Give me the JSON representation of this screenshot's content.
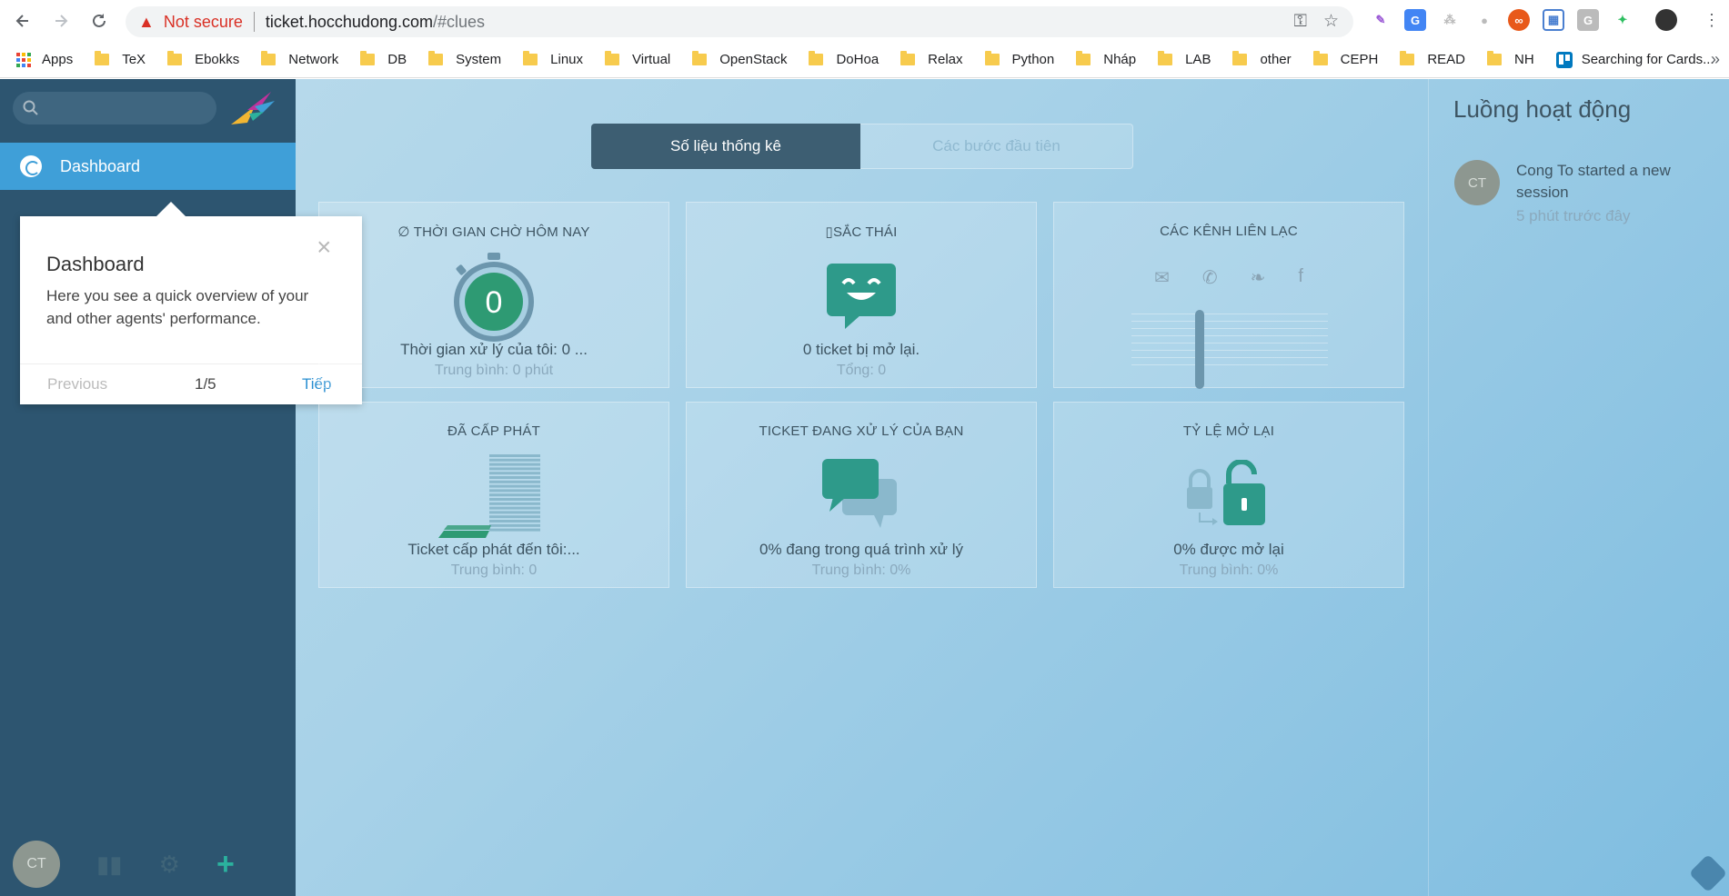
{
  "browser": {
    "security_label": "Not secure",
    "url_host": "ticket.hocchudong.com",
    "url_path": "/#clues",
    "bookmarks": [
      {
        "label": "Apps",
        "kind": "apps"
      },
      {
        "label": "TeX",
        "kind": "folder"
      },
      {
        "label": "Ebokks",
        "kind": "folder"
      },
      {
        "label": "Network",
        "kind": "folder"
      },
      {
        "label": "DB",
        "kind": "folder"
      },
      {
        "label": "System",
        "kind": "folder"
      },
      {
        "label": "Linux",
        "kind": "folder"
      },
      {
        "label": "Virtual",
        "kind": "folder"
      },
      {
        "label": "OpenStack",
        "kind": "folder"
      },
      {
        "label": "DoHoa",
        "kind": "folder"
      },
      {
        "label": "Relax",
        "kind": "folder"
      },
      {
        "label": "Python",
        "kind": "folder"
      },
      {
        "label": "Nháp",
        "kind": "folder"
      },
      {
        "label": "LAB",
        "kind": "folder"
      },
      {
        "label": "other",
        "kind": "folder"
      },
      {
        "label": "CEPH",
        "kind": "folder"
      },
      {
        "label": "READ",
        "kind": "folder"
      },
      {
        "label": "NH",
        "kind": "folder"
      },
      {
        "label": "Searching for Cards...",
        "kind": "trello"
      }
    ]
  },
  "sidebar": {
    "dashboard_label": "Dashboard",
    "user_initials": "CT"
  },
  "tooltip": {
    "title": "Dashboard",
    "body": "Here you see a quick overview of your and other agents' performance.",
    "previous": "Previous",
    "step": "1/5",
    "next": "Tiếp"
  },
  "tabs": {
    "stats": "Số liệu thống kê",
    "first_steps": "Các bước đầu tiên"
  },
  "cards": {
    "waiting": {
      "title": "∅ THỜI GIAN CHỜ HÔM NAY",
      "value": "0",
      "main": "Thời gian xử lý của tôi: 0 ...",
      "sub": "Trung bình: 0 phút"
    },
    "mood": {
      "title": "▯SẮC THÁI",
      "main": "0 ticket bị mở lại.",
      "sub": "Tổng: 0"
    },
    "channels": {
      "title": "CÁC KÊNH LIÊN LẠC"
    },
    "assigned": {
      "title": "ĐÃ CẤP PHÁT",
      "main": "Ticket cấp phát đến tôi:...",
      "sub": "Trung bình: 0"
    },
    "in_process": {
      "title": "TICKET ĐANG XỬ LÝ CỦA BẠN",
      "main": "0% đang trong quá trình xử lý",
      "sub": "Trung bình: 0%"
    },
    "reopen": {
      "title": "TỶ LỆ MỞ LẠI",
      "main": "0% được mở lại",
      "sub": "Trung bình: 0%"
    }
  },
  "activity": {
    "title": "Luồng hoạt động",
    "initials": "CT",
    "text": "Cong To started a new session",
    "time": "5 phút trước đây"
  },
  "colors": {
    "sidebar": "#2d5570",
    "accent": "#3f9fd8",
    "teal": "#2bb19e"
  }
}
